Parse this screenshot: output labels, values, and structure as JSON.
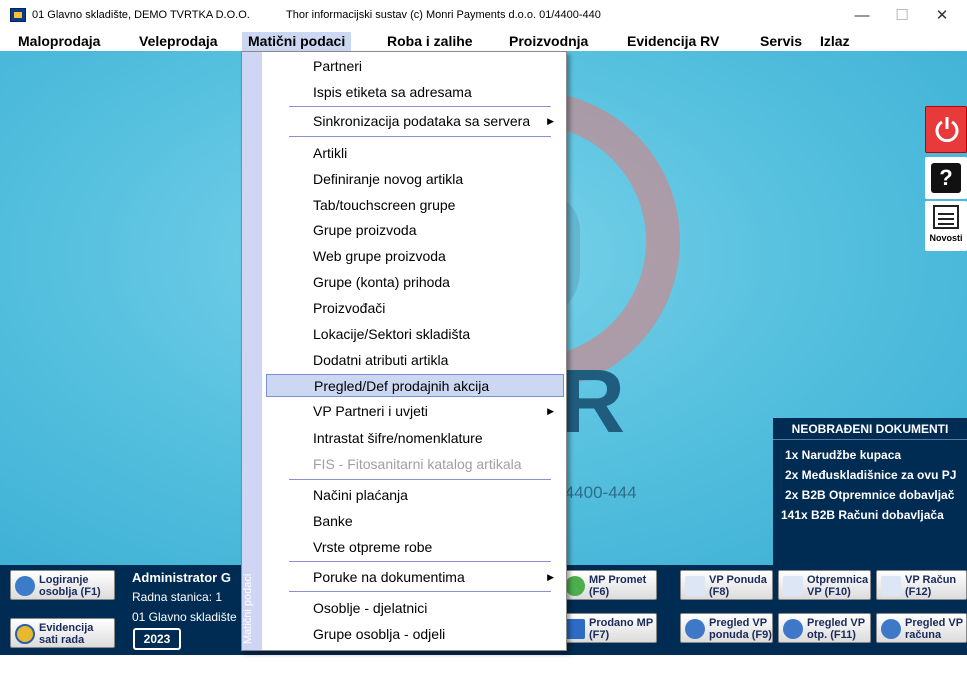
{
  "window": {
    "title_left": "01 Glavno skladište, DEMO TVRTKA D.O.O.",
    "title_center": "Thor informacijski sustav (c) Monri Payments d.o.o. 01/4400-440",
    "minimize": "—",
    "maximize": "☐",
    "close": "✕"
  },
  "menu": {
    "items": [
      "Maloprodaja",
      "Veleprodaja",
      "Matični podaci",
      "Roba i zalihe",
      "Proizvodnja",
      "Evidencija RV",
      "Servis",
      "Izlaz"
    ],
    "active_index": 2
  },
  "dropdown": {
    "side_label": "Matični podaci",
    "items": [
      {
        "label": "Partneri"
      },
      {
        "label": "Ispis etiketa sa adresama"
      },
      {
        "label": "Sinkronizacija podataka sa servera",
        "submenu": true
      },
      {
        "label": "Artikli"
      },
      {
        "label": "Definiranje novog artikla"
      },
      {
        "label": "Tab/touchscreen grupe"
      },
      {
        "label": "Grupe proizvoda"
      },
      {
        "label": "Web grupe proizvoda"
      },
      {
        "label": "Grupe (konta) prihoda"
      },
      {
        "label": "Proizvođači"
      },
      {
        "label": "Lokacije/Sektori skladišta"
      },
      {
        "label": "Dodatni atributi artikla"
      },
      {
        "label": "Pregled/Def prodajnih akcija",
        "selected": true
      },
      {
        "label": "VP Partneri i uvjeti",
        "submenu": true
      },
      {
        "label": "Intrastat šifre/nomenklature"
      },
      {
        "label": "FIS - Fitosanitarni katalog artikala",
        "disabled": true
      },
      {
        "label": "Načini plaćanja"
      },
      {
        "label": "Banke"
      },
      {
        "label": "Vrste otpreme robe"
      },
      {
        "label": "Poruke na dokumentima",
        "submenu": true
      },
      {
        "label": "Osoblje - djelatnici"
      },
      {
        "label": "Grupe osoblja - odjeli"
      }
    ]
  },
  "desktop": {
    "logo_letter": "R",
    "phone": "/4400-444"
  },
  "side_buttons": {
    "power_icon": "power-icon",
    "help_label": "?",
    "news_label": "Novosti"
  },
  "docs_panel": {
    "title": "NEOBRAĐENI DOKUMENTI",
    "rows": [
      "1x Narudžbe kupaca",
      "2x Međuskladišnice za ovu PJ",
      "2x B2B Otpremnice dobavljač",
      "141x B2B Računi dobavljača"
    ]
  },
  "bottom": {
    "login_btn": [
      "Logiranje",
      "osoblja (F1)"
    ],
    "time_btn": [
      "Evidencija",
      "sati rada"
    ],
    "user_name": "Administrator G",
    "station": "Radna stanica: 1",
    "warehouse": "01 Glavno skladište",
    "year": "2023",
    "buttons": [
      {
        "l1": "MP Promet",
        "l2": "(F6)"
      },
      {
        "l1": "Prodano MP",
        "l2": "(F7)"
      },
      {
        "l1": "VP Ponuda",
        "l2": "(F8)"
      },
      {
        "l1": "Pregled VP",
        "l2": "ponuda (F9)"
      },
      {
        "l1": "Otpremnica",
        "l2": "VP (F10)"
      },
      {
        "l1": "Pregled VP",
        "l2": "otp. (F11)"
      },
      {
        "l1": "VP Račun",
        "l2": "(F12)"
      },
      {
        "l1": "Pregled VP",
        "l2": "računa"
      }
    ]
  },
  "colors": {
    "accent": "#002b52",
    "menu_highlight": "#ccd8f2",
    "power": "#e83a3a"
  }
}
